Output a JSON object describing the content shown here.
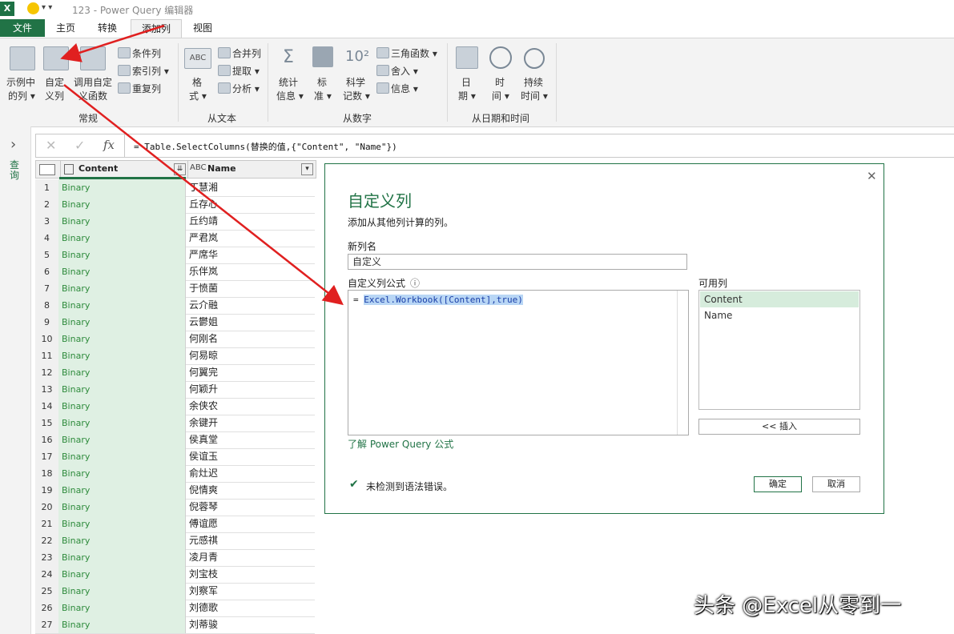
{
  "window": {
    "app_icon": "X",
    "title": "123 - Power Query 编辑器"
  },
  "tabs": [
    {
      "label": "文件"
    },
    {
      "label": "主页"
    },
    {
      "label": "转换"
    },
    {
      "label": "添加列"
    },
    {
      "label": "视图"
    }
  ],
  "ribbon": {
    "example_col": [
      "示例中",
      "的列 ▾"
    ],
    "custom_col": [
      "自定",
      "义列"
    ],
    "invoke_func": [
      "调用自定",
      "义函数"
    ],
    "conditional_col": "条件列",
    "index_col": "索引列 ▾",
    "duplicate_col": "重复列",
    "format": [
      "格",
      "式 ▾"
    ],
    "merge_cols": "合并列",
    "extract": "提取 ▾",
    "parse": "分析 ▾",
    "statistics": [
      "统计",
      "信息 ▾"
    ],
    "standard": [
      "标",
      "准 ▾"
    ],
    "scientific": [
      "科学",
      "记数 ▾"
    ],
    "trig": "三角函数 ▾",
    "rounding": "舍入 ▾",
    "information": "信息 ▾",
    "date": [
      "日",
      "期 ▾"
    ],
    "time": [
      "时",
      "间 ▾"
    ],
    "duration": [
      "持续",
      "时间 ▾"
    ],
    "group_general": "常规",
    "group_text": "从文本",
    "group_number": "从数字",
    "group_datetime": "从日期和时间"
  },
  "formula_bar": {
    "cancel_glyph": "✕",
    "confirm_glyph": "✓",
    "fx_glyph": "fx",
    "formula": "= Table.SelectColumns(替换的值,{\"Content\", \"Name\"})"
  },
  "side": {
    "expand_glyph": "›",
    "vertical_label": "查询"
  },
  "table": {
    "headers": [
      "Content",
      "Name"
    ],
    "rows": [
      {
        "n": "1",
        "content": "Binary",
        "name": "丁慧湘"
      },
      {
        "n": "2",
        "content": "Binary",
        "name": "丘存心"
      },
      {
        "n": "3",
        "content": "Binary",
        "name": "丘约靖"
      },
      {
        "n": "4",
        "content": "Binary",
        "name": "严君岚"
      },
      {
        "n": "5",
        "content": "Binary",
        "name": "严席华"
      },
      {
        "n": "6",
        "content": "Binary",
        "name": "乐伴岚"
      },
      {
        "n": "7",
        "content": "Binary",
        "name": "于愤菌"
      },
      {
        "n": "8",
        "content": "Binary",
        "name": "云介融"
      },
      {
        "n": "9",
        "content": "Binary",
        "name": "云鬱姐"
      },
      {
        "n": "10",
        "content": "Binary",
        "name": "何刚名"
      },
      {
        "n": "11",
        "content": "Binary",
        "name": "何易晾"
      },
      {
        "n": "12",
        "content": "Binary",
        "name": "何翼完"
      },
      {
        "n": "13",
        "content": "Binary",
        "name": "何颖升"
      },
      {
        "n": "14",
        "content": "Binary",
        "name": "余侠农"
      },
      {
        "n": "15",
        "content": "Binary",
        "name": "余键开"
      },
      {
        "n": "16",
        "content": "Binary",
        "name": "侯真堂"
      },
      {
        "n": "17",
        "content": "Binary",
        "name": "侯谊玉"
      },
      {
        "n": "18",
        "content": "Binary",
        "name": "俞灶迟"
      },
      {
        "n": "19",
        "content": "Binary",
        "name": "倪情爽"
      },
      {
        "n": "20",
        "content": "Binary",
        "name": "倪蓉琴"
      },
      {
        "n": "21",
        "content": "Binary",
        "name": "傅谊愿"
      },
      {
        "n": "22",
        "content": "Binary",
        "name": "元感祺"
      },
      {
        "n": "23",
        "content": "Binary",
        "name": "凌月青"
      },
      {
        "n": "24",
        "content": "Binary",
        "name": "刘宝枝"
      },
      {
        "n": "25",
        "content": "Binary",
        "name": "刘察军"
      },
      {
        "n": "26",
        "content": "Binary",
        "name": "刘德歌"
      },
      {
        "n": "27",
        "content": "Binary",
        "name": "刘蒂骏"
      }
    ]
  },
  "dialog": {
    "close_glyph": "✕",
    "title": "自定义列",
    "subtitle": "添加从其他列计算的列。",
    "new_col_label": "新列名",
    "new_col_value": "自定义",
    "formula_label": "自定义列公式",
    "info_glyph": "ⓘ",
    "formula_prefix": "= ",
    "formula_selected": "Excel.Workbook([Content],true)",
    "available_label": "可用列",
    "available": [
      "Content",
      "Name"
    ],
    "insert_button": "<< 插入",
    "learn_link": "了解 Power Query 公式",
    "check_glyph": "✔",
    "status": "未检测到语法错误。",
    "ok": "确定",
    "cancel": "取消"
  },
  "watermark": "头条 @Excel从零到一",
  "colors": {
    "accent": "#217346",
    "arrow": "#e02020",
    "content_fill": "#dff0e3",
    "selection": "#b8d6f5"
  }
}
